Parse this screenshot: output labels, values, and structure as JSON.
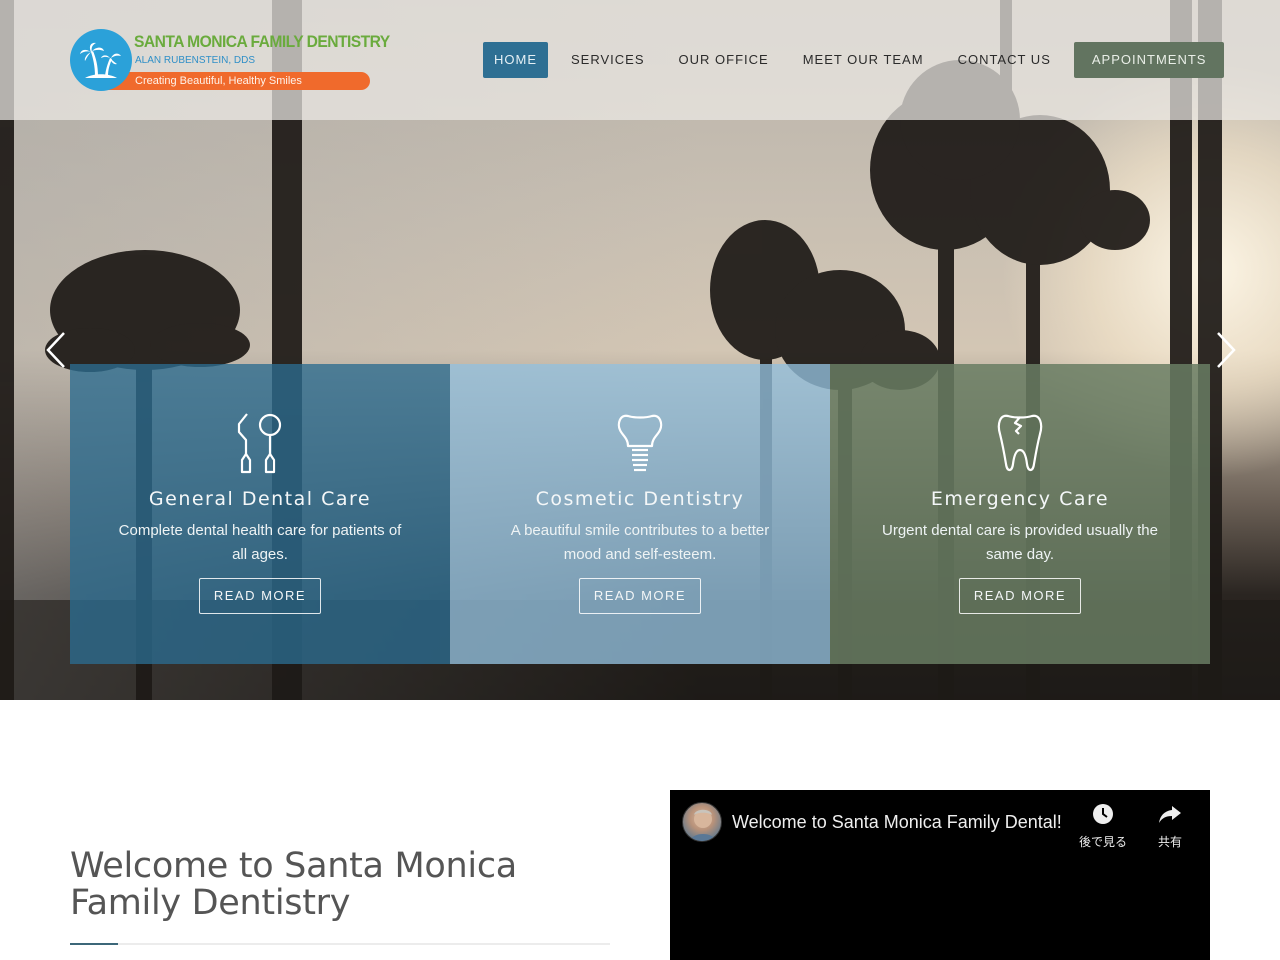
{
  "header": {
    "logo": {
      "title": "SANTA MONICA FAMILY DENTISTRY",
      "subtitle": "ALAN RUBENSTEIN, DDS",
      "tagline": "Creating Beautiful, Healthy Smiles",
      "icon": "palm-island-icon"
    },
    "nav": [
      {
        "label": "HOME",
        "active": true
      },
      {
        "label": "SERVICES",
        "active": false
      },
      {
        "label": "OUR OFFICE",
        "active": false
      },
      {
        "label": "MEET OUR TEAM",
        "active": false
      },
      {
        "label": "CONTACT US",
        "active": false
      }
    ],
    "appointments_label": "APPOINTMENTS"
  },
  "hero": {
    "prev_icon": "chevron-left-icon",
    "next_icon": "chevron-right-icon",
    "panels": [
      {
        "icon": "dental-tools-icon",
        "title": "General Dental Care",
        "description": "Complete dental health care for patients of all ages.",
        "button": "READ MORE"
      },
      {
        "icon": "dental-implant-icon",
        "title": "Cosmetic Dentistry",
        "description": "A beautiful smile contributes to a better mood and self-esteem.",
        "button": "READ MORE"
      },
      {
        "icon": "cracked-tooth-icon",
        "title": "Emergency Care",
        "description": "Urgent dental care is provided usually the same day.",
        "button": "READ MORE"
      }
    ]
  },
  "welcome": {
    "title": "Welcome to Santa Monica Family Dentistry"
  },
  "video": {
    "title": "Welcome to Santa Monica Family Dental!",
    "watch_later_label": "後で見る",
    "share_label": "共有"
  },
  "colors": {
    "nav_active": "#2e6f93",
    "appointments": "#627460",
    "panel_general": "#2c6c8f",
    "panel_cosmetic": "#93c0de",
    "panel_emergency": "#687d63",
    "logo_green": "#6aab3d",
    "logo_blue": "#2ba1d9",
    "logo_orange": "#f06a2c"
  }
}
